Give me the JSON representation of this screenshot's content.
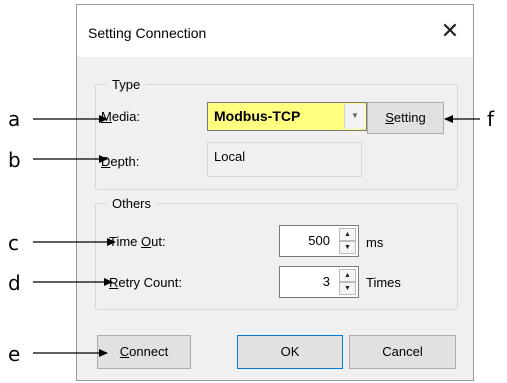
{
  "dialog": {
    "title": "Setting Connection",
    "close_symbol": "✕"
  },
  "type_group": {
    "legend": "Type",
    "media_label_key": "M",
    "media_label_rest": "edia:",
    "media_value": "Modbus-TCP",
    "setting_key": "S",
    "setting_rest": "etting",
    "depth_label_key": "D",
    "depth_label_rest": "epth:",
    "depth_value": "Local"
  },
  "others_group": {
    "legend": "Others",
    "timeout_label_pre": "Time ",
    "timeout_label_key": "O",
    "timeout_label_rest": "ut:",
    "timeout_value": "500",
    "timeout_unit": "ms",
    "retry_label_key": "R",
    "retry_label_rest": "etry Count:",
    "retry_value": "3",
    "retry_unit": "Times"
  },
  "buttons": {
    "connect_key": "C",
    "connect_rest": "onnect",
    "ok": "OK",
    "cancel": "Cancel"
  },
  "callouts": {
    "a": "a",
    "b": "b",
    "c": "c",
    "d": "d",
    "e": "e",
    "f": "f"
  },
  "colors": {
    "combo_highlight": "#ffff80",
    "ok_border": "#0078d7"
  }
}
